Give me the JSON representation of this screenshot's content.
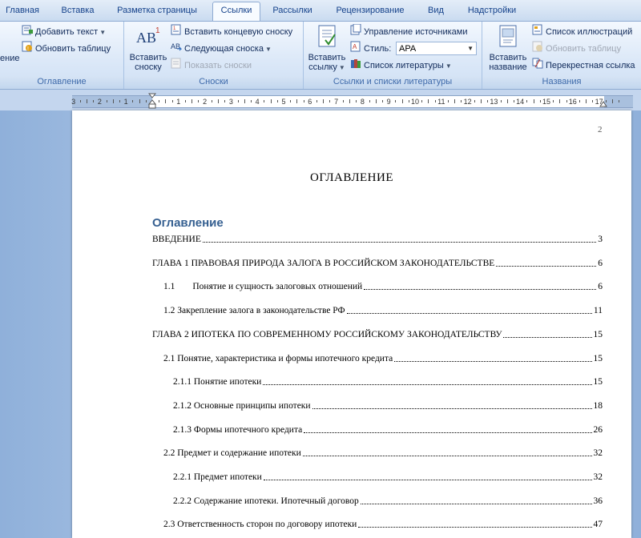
{
  "tabs": [
    "Главная",
    "Вставка",
    "Разметка страницы",
    "Ссылки",
    "Рассылки",
    "Рецензирование",
    "Вид",
    "Надстройки"
  ],
  "active_tab": "Ссылки",
  "ribbon": {
    "toc_group": {
      "partial_button": "ение",
      "add_text": "Добавить текст",
      "update_table": "Обновить таблицу",
      "label": "Оглавление"
    },
    "footnotes_group": {
      "insert_footnote": [
        "Вставить",
        "сноску"
      ],
      "insert_endnote": "Вставить концевую сноску",
      "next_footnote": "Следующая сноска",
      "show_notes": "Показать сноски",
      "label": "Сноски"
    },
    "citations_group": {
      "insert_citation": [
        "Вставить",
        "ссылку"
      ],
      "manage_sources": "Управление источниками",
      "style_label": "Стиль:",
      "style_value": "APA",
      "bibliography": "Список литературы",
      "label": "Ссылки и списки литературы"
    },
    "captions_group": {
      "insert_caption": [
        "Вставить",
        "название"
      ],
      "table_of_figures": "Список иллюстраций",
      "update_table": "Обновить таблицу",
      "cross_reference": "Перекрестная ссылка",
      "label": "Названия"
    }
  },
  "ruler": {
    "numbers": [
      "3",
      "2",
      "1",
      "",
      "1",
      "2",
      "3",
      "4",
      "5",
      "6",
      "7",
      "8",
      "9",
      "10",
      "11",
      "12",
      "13",
      "14",
      "15",
      "16",
      "17"
    ]
  },
  "document": {
    "page_number": "2",
    "title": "ОГЛАВЛЕНИЕ",
    "toc_heading": "Оглавление",
    "entries": [
      {
        "text": "ВВЕДЕНИЕ",
        "page": "3"
      },
      {
        "text": "ГЛАВА 1 ПРАВОВАЯ ПРИРОДА ЗАЛОГА В РОССИЙСКОМ ЗАКОНОДАТЕЛЬСТВЕ",
        "page": "6"
      },
      {
        "number": "1.1",
        "text": "Понятие и сущность залоговых отношений",
        "page": "6"
      },
      {
        "text": "1.2 Закрепление залога в законодательстве РФ",
        "page": "11"
      },
      {
        "text": "ГЛАВА 2 ИПОТЕКА ПО СОВРЕМЕННОМУ РОССИЙСКОМУ ЗАКОНОДАТЕЛЬСТВУ",
        "page": "15"
      },
      {
        "text": "2.1 Понятие, характеристика и формы ипотечного кредита",
        "page": "15"
      },
      {
        "text": "2.1.1 Понятие ипотеки",
        "page": "15"
      },
      {
        "text": "2.1.2 Основные принципы ипотеки",
        "page": "18"
      },
      {
        "text": "2.1.3 Формы ипотечного кредита",
        "page": "26"
      },
      {
        "text": "2.2 Предмет и содержание ипотеки",
        "page": "32"
      },
      {
        "text": "2.2.1 Предмет ипотеки",
        "page": "32"
      },
      {
        "text": "2.2.2 Содержание ипотеки. Ипотечный договор",
        "page": "36"
      },
      {
        "text": "2.3 Ответственность сторон по договору ипотеки",
        "page": "47"
      }
    ]
  }
}
